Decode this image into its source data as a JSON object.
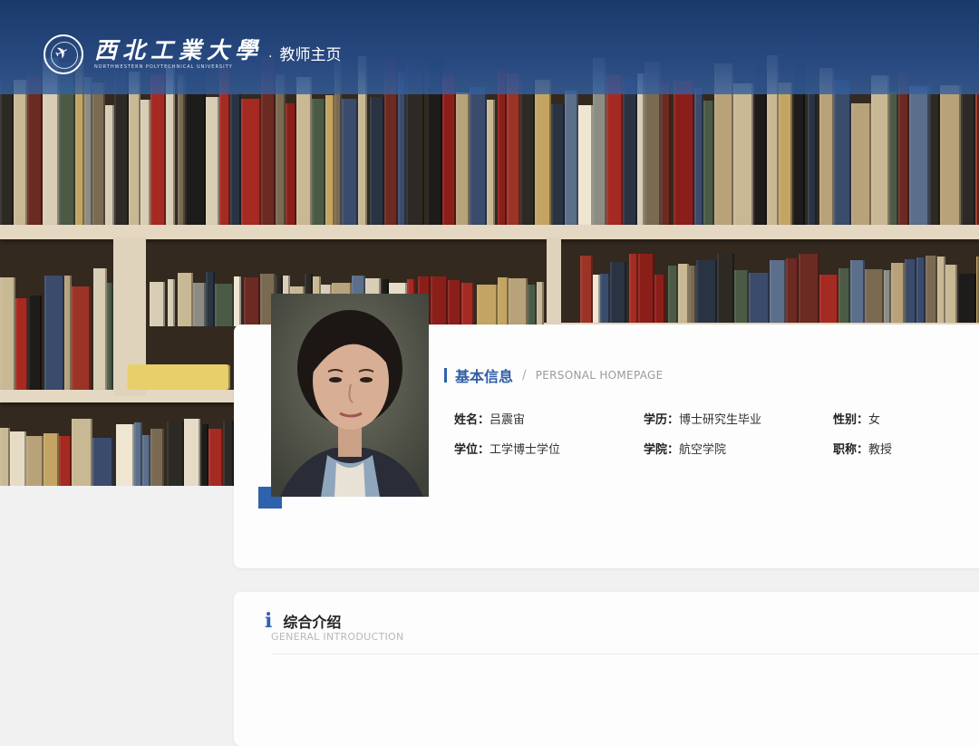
{
  "header": {
    "university_cn": "西北工業大學",
    "university_en": "NORTHWESTERN POLYTECHNICAL UNIVERSITY",
    "separator": "·",
    "subtitle": "教师主页",
    "bar_color": "#1f4a8c"
  },
  "profile": {
    "section_title": "基本信息",
    "section_sep": "/",
    "section_en": "PERSONAL HOMEPAGE",
    "fields": [
      {
        "label": "姓名：",
        "value": "吕震宙"
      },
      {
        "label": "学历：",
        "value": "博士研究生毕业"
      },
      {
        "label": "性别：",
        "value": "女"
      },
      {
        "label": "学位：",
        "value": "工学博士学位"
      },
      {
        "label": "学院：",
        "value": "航空学院"
      },
      {
        "label": "职称：",
        "value": "教授"
      }
    ],
    "accent_color": "#2f62ad"
  },
  "intro": {
    "icon": "i",
    "title": "综合介绍",
    "subtitle_en": "GENERAL INTRODUCTION"
  }
}
